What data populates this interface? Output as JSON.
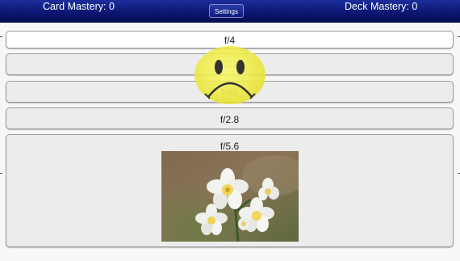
{
  "header": {
    "card_mastery": "Card Mastery: 0",
    "deck_mastery": "Deck Mastery: 0",
    "settings_label": "Settings"
  },
  "answers": [
    {
      "label": "f/4"
    },
    {
      "label": "f/22"
    },
    {
      "label": "f/90"
    },
    {
      "label": "f/2.8"
    },
    {
      "label": "f/5.6"
    }
  ],
  "feedback": {
    "icon": "sad-face-icon",
    "color": "#f2ef3a"
  },
  "photo": {
    "icon": "daffodil-flower-photo"
  },
  "colors": {
    "header_bg": "#0a1670",
    "card_bg": "#ececec",
    "selected_bg": "#ffffff"
  }
}
